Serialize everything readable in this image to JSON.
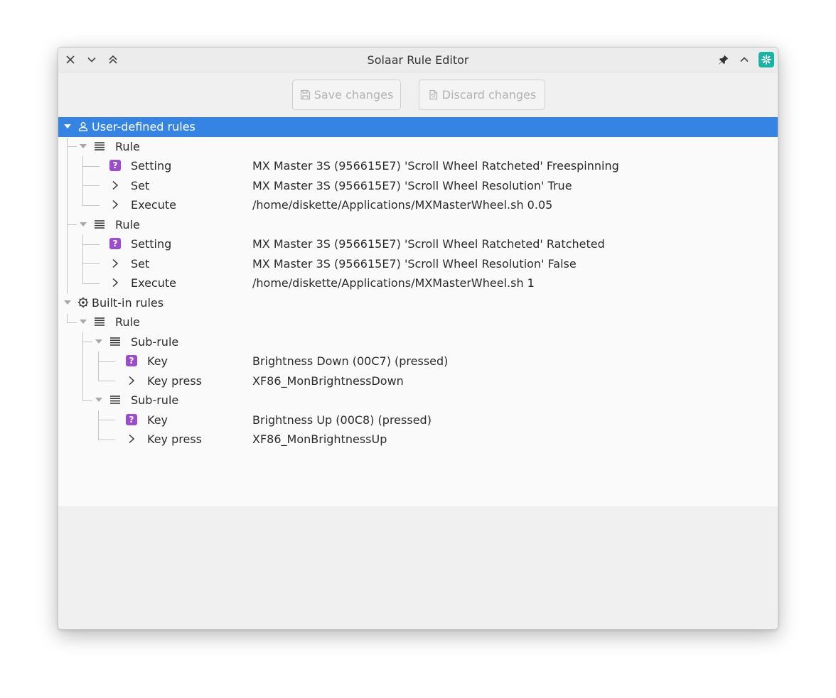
{
  "window": {
    "title": "Solaar Rule Editor"
  },
  "toolbar": {
    "save_label": "Save changes",
    "discard_label": "Discard changes"
  },
  "tree": {
    "user_rules": "User-defined rules",
    "rule1": {
      "label": "Rule",
      "setting": {
        "label": "Setting",
        "value": "MX Master 3S (956615E7)  'Scroll Wheel Ratcheted'  Freespinning"
      },
      "set": {
        "label": "Set",
        "value": "MX Master 3S (956615E7)  'Scroll Wheel Resolution'  True"
      },
      "execute": {
        "label": "Execute",
        "value": "/home/diskette/Applications/MXMasterWheel.sh 0.05"
      }
    },
    "rule2": {
      "label": "Rule",
      "setting": {
        "label": "Setting",
        "value": "MX Master 3S (956615E7)  'Scroll Wheel Ratcheted'  Ratcheted"
      },
      "set": {
        "label": "Set",
        "value": "MX Master 3S (956615E7)  'Scroll Wheel Resolution'  False"
      },
      "execute": {
        "label": "Execute",
        "value": "/home/diskette/Applications/MXMasterWheel.sh 1"
      }
    },
    "builtin_rules": "Built-in rules",
    "rule3": {
      "label": "Rule",
      "sub1": {
        "label": "Sub-rule",
        "key": {
          "label": "Key",
          "value": "Brightness Down (00C7) (pressed)"
        },
        "keypress": {
          "label": "Key press",
          "value": "XF86_MonBrightnessDown"
        }
      },
      "sub2": {
        "label": "Sub-rule",
        "key": {
          "label": "Key",
          "value": "Brightness Up (00C8) (pressed)"
        },
        "keypress": {
          "label": "Key press",
          "value": "XF86_MonBrightnessUp"
        }
      }
    }
  },
  "colors": {
    "selection": "#3584e4",
    "question_badge": "#9b4dca",
    "app_icon": "#17b3a4"
  }
}
